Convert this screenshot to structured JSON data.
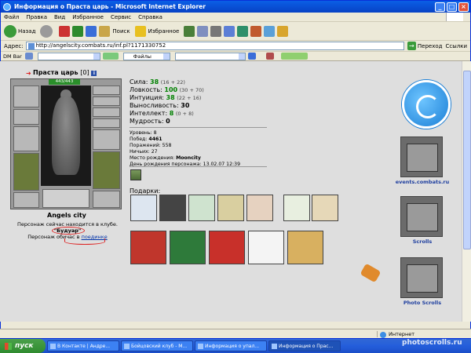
{
  "window": {
    "title": "Информация о Праста царь - Microsoft Internet Explorer",
    "buttons": [
      "_",
      "□",
      "×"
    ]
  },
  "menu": [
    "Файл",
    "Правка",
    "Вид",
    "Избранное",
    "Сервис",
    "Справка"
  ],
  "toolbar": {
    "back": "Назад",
    "search": "Поиск",
    "favorites": "Избранное"
  },
  "address": {
    "label": "Адрес:",
    "url": "http://angelscity.combats.ru/inf.pl?1171330752",
    "go": "Переход",
    "links": "Ссылки"
  },
  "linkbar": {
    "left": "DM Bar",
    "files": "Файлы"
  },
  "character": {
    "name": "Праста царь",
    "level": "[0]",
    "info_icon": "i",
    "hp": "443/443",
    "city": "Angels city",
    "status_line1": "Персонаж сейчас находится в клубе.",
    "status_line2": "\"Будуар\"",
    "status_line3_prefix": "Персонаж обичас в ",
    "status_line3_link": "поединке"
  },
  "stats": [
    {
      "label": "Сила:",
      "value": "38",
      "extra": "(16 + 22)",
      "colored": true
    },
    {
      "label": "Ловкость:",
      "value": "100",
      "extra": "(30 + 70)",
      "colored": true
    },
    {
      "label": "Интуиция:",
      "value": "38",
      "extra": "(22 + 16)",
      "colored": true
    },
    {
      "label": "Выносливость:",
      "value": "30",
      "extra": "",
      "colored": false
    },
    {
      "label": "Интеллект:",
      "value": "8",
      "extra": "(0 + 8)",
      "colored": true
    },
    {
      "label": "Мудрость:",
      "value": "0",
      "extra": "",
      "colored": false
    }
  ],
  "info": {
    "level": "Уровень: 8",
    "wins_label": "Побед: ",
    "wins": "4461",
    "losses": "Поражений: 558",
    "draws": "Ничьих: 27",
    "birthplace_label": "Место рождения: ",
    "birthplace": "Mooncity",
    "birthday": "День рождения персонажа: 13.02.07 12:39"
  },
  "gifts_label": "Подарки:",
  "side": {
    "events": "events.combats.ru",
    "scrolls": "Scrolls",
    "photo_scrolls": "Photo Scrolls"
  },
  "status_bar": {
    "zone": "Интернет"
  },
  "taskbar": {
    "start": "пуск",
    "tasks": [
      "В Контакте | Андре...",
      "Бойцовский клуб - М...",
      "Информация о упал...",
      "Информация о Прас..."
    ]
  },
  "watermark": "photoscrolls.ru",
  "colors": {
    "accent": "#0a5fe6",
    "stat_green": "#008000",
    "link_blue": "#0033aa"
  }
}
